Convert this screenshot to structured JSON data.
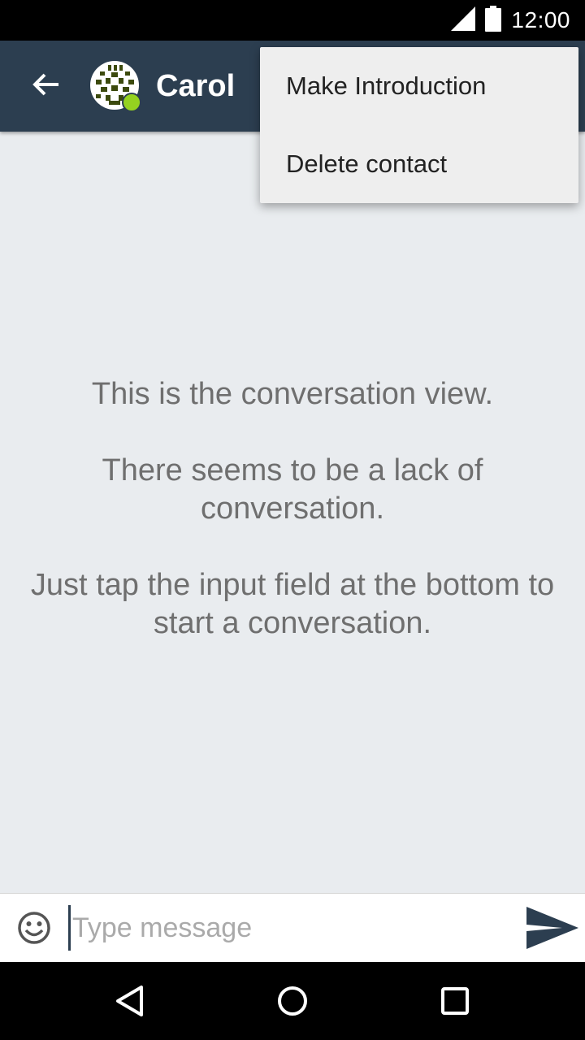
{
  "status_bar": {
    "time": "12:00",
    "icons": [
      "signal-icon",
      "battery-icon"
    ]
  },
  "toolbar": {
    "back_icon": "arrow-left-icon",
    "contact_name": "Carol",
    "online": true,
    "colors": {
      "background": "#2c3e50",
      "online_dot": "#95d220"
    }
  },
  "overflow_menu": {
    "items": [
      {
        "label": "Make Introduction"
      },
      {
        "label": "Delete contact"
      }
    ]
  },
  "conversation": {
    "empty_state": [
      "This is the conversation view.",
      "There seems to be a lack of conversation.",
      "Just tap the input field at the bottom to start a conversation."
    ]
  },
  "composer": {
    "emoji_icon": "smiley-icon",
    "placeholder": "Type message",
    "value": "",
    "send_icon": "send-icon"
  },
  "navigation_bar": {
    "buttons": [
      "back-triangle-icon",
      "home-circle-icon",
      "recents-square-icon"
    ]
  }
}
